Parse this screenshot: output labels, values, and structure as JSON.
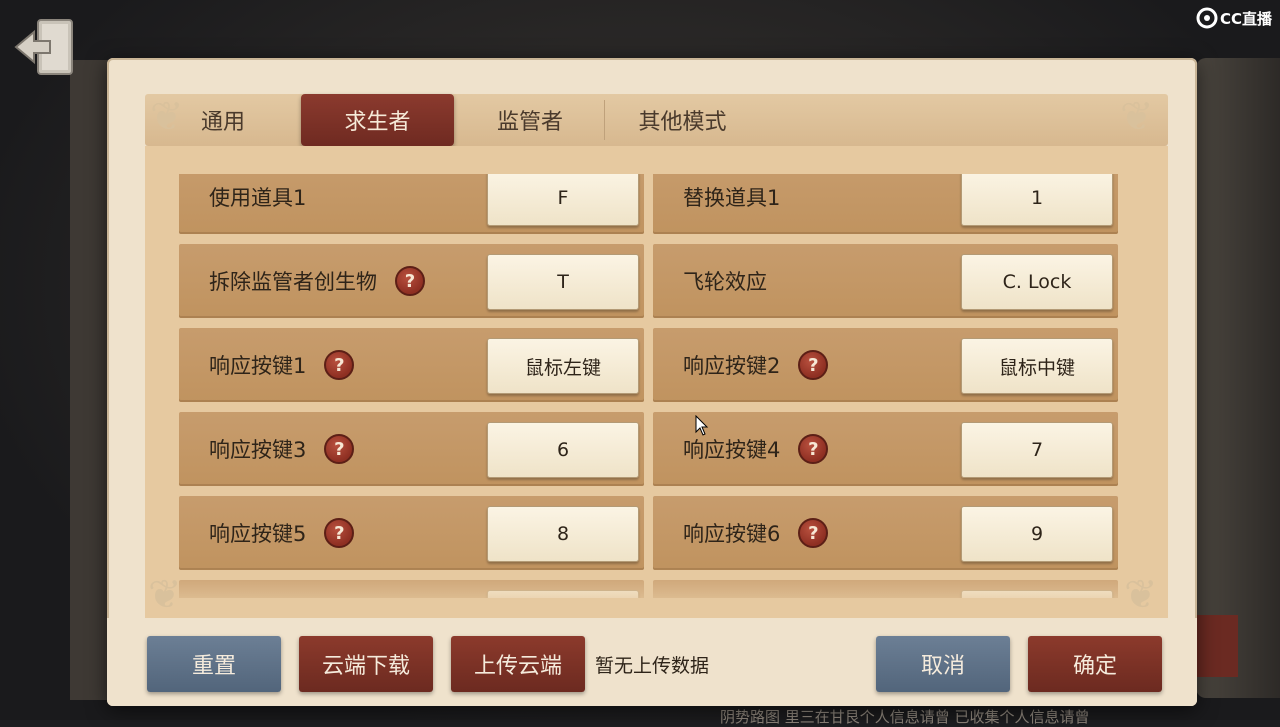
{
  "watermark": {
    "label": "CC直播"
  },
  "background": {
    "bottom_text": "阴势路图      里三在甘艮个人信息请曾      已收集个人信息请曾"
  },
  "tabs": [
    {
      "label": "通用"
    },
    {
      "label": "求生者"
    },
    {
      "label": "监管者"
    },
    {
      "label": "其他模式"
    }
  ],
  "active_tab": "求生者",
  "settings": [
    {
      "label": "使用道具1",
      "key": "F",
      "help": false
    },
    {
      "label": "替换道具1",
      "key": "1",
      "help": false
    },
    {
      "label": "拆除监管者创生物",
      "key": "T",
      "help": true
    },
    {
      "label": "飞轮效应",
      "key": "C. Lock",
      "help": false
    },
    {
      "label": "响应按键1",
      "key": "鼠标左键",
      "help": true
    },
    {
      "label": "响应按键2",
      "key": "鼠标中键",
      "help": true
    },
    {
      "label": "响应按键3",
      "key": "6",
      "help": true
    },
    {
      "label": "响应按键4",
      "key": "7",
      "help": true
    },
    {
      "label": "响应按键5",
      "key": "8",
      "help": true
    },
    {
      "label": "响应按键6",
      "key": "9",
      "help": true
    }
  ],
  "help_glyph": "?",
  "footer": {
    "reset": "重置",
    "cloud_download": "云端下载",
    "cloud_upload": "上传云端",
    "status": "暂无上传数据",
    "cancel": "取消",
    "confirm": "确定"
  },
  "colors": {
    "active_tab": "#7a3027",
    "cell": "#c4986a",
    "blue_button": "#5e7188",
    "red_button": "#7a3027"
  },
  "icons": [
    "back-exit-icon",
    "question-mark-icon",
    "cc-live-logo-icon",
    "mouse-cursor-icon"
  ]
}
